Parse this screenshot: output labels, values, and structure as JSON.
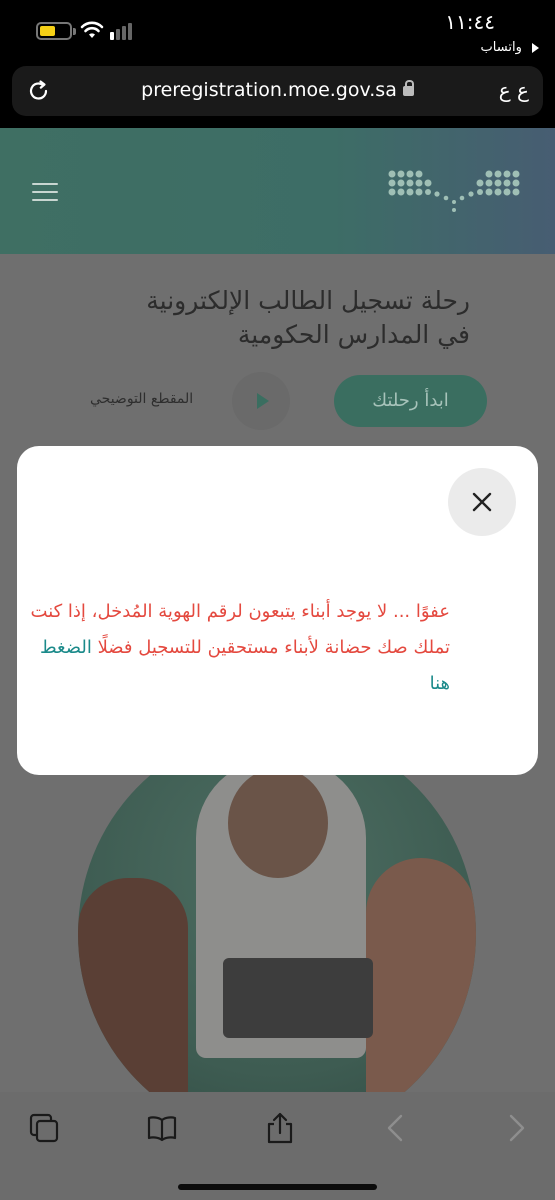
{
  "status_bar": {
    "time": "١١:٤٤",
    "back_app": "واتساب",
    "battery_level": 0.55,
    "colors": {
      "battery": "#f5d016"
    }
  },
  "browser": {
    "url": "preregistration.moe.gov.sa",
    "reader_label": "ع ع",
    "icons": [
      "reload-icon",
      "lock-icon"
    ]
  },
  "site": {
    "hero_title_line1": "رحلة تسجيل الطالب الإلكترونية",
    "hero_title_line2": "في المدارس الحكومية",
    "start_button": "ابدأ رحلتك",
    "video_label": "المقطع التوضيحي",
    "colors": {
      "brand": "#3a6e60"
    }
  },
  "modal": {
    "message_part1": "عفوًا ... لا يوجد أبناء يتبعون لرقم الهوية المُدخل، إذا كنت تملك صك حضانة لأبناء مستحقين للتسجيل فضلًا",
    "link_text": "الضغط هنا",
    "colors": {
      "message": "#e4493f",
      "link": "#1b8a8a"
    }
  },
  "toolbar": {
    "icons": [
      "tabs-icon",
      "bookmarks-icon",
      "share-icon",
      "back-arrow-icon",
      "forward-arrow-icon"
    ]
  }
}
